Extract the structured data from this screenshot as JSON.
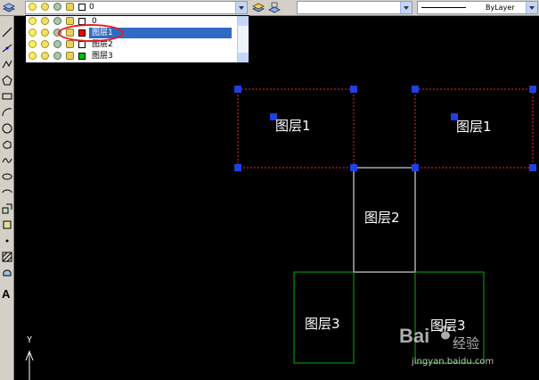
{
  "toolbar": {
    "current_layer": "0",
    "linetype_value": "ByLayer"
  },
  "layer_dropdown": {
    "items": [
      {
        "name": "0",
        "color": "#ffffff",
        "selected": false
      },
      {
        "name": "图层1",
        "color": "#ff0000",
        "selected": true
      },
      {
        "name": "图层2",
        "color": "#ffffff",
        "selected": false
      },
      {
        "name": "图层3",
        "color": "#00c000",
        "selected": false
      }
    ]
  },
  "left_toolbar": {
    "text_tool_glyph": "A"
  },
  "canvas": {
    "labels": {
      "layer1_left": "图层1",
      "layer1_right": "图层1",
      "layer2": "图层2",
      "layer3_left": "图层3",
      "layer3_right": "图层3"
    },
    "ucs_y_axis": "Y",
    "colors": {
      "layer1": "#ff2020",
      "layer2": "#ffffff",
      "layer3": "#00b000",
      "grip": "#2040e0"
    }
  },
  "watermark": {
    "brand": "Bai",
    "brand_suffix": "经验",
    "url": "jingyan.baidu.com"
  }
}
